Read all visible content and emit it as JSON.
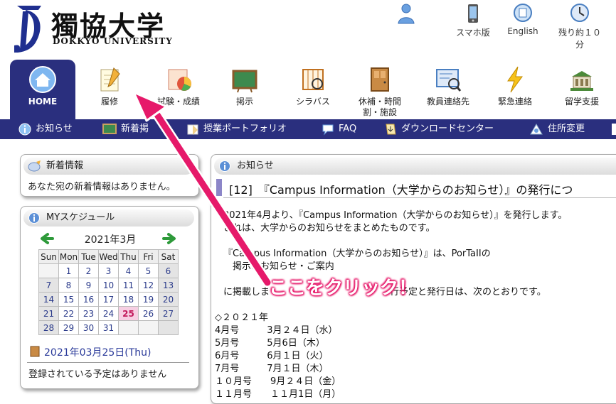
{
  "header": {
    "univ_name_jp": "獨協大学",
    "univ_name_en": "DOKKYO UNIVERSITY",
    "links": [
      {
        "label": "",
        "icon": "user-icon"
      },
      {
        "label": "スマホ版",
        "icon": "smartphone-icon"
      },
      {
        "label": "English",
        "icon": "english-icon"
      },
      {
        "label": "残り約１０分",
        "icon": "clock-icon"
      }
    ]
  },
  "menu": [
    {
      "label": "HOME",
      "icon": "home-icon"
    },
    {
      "label": "履修",
      "icon": "notepad-icon"
    },
    {
      "label": "試験・成績",
      "icon": "chart-icon"
    },
    {
      "label": "掲示",
      "icon": "board-icon"
    },
    {
      "label": "シラバス",
      "icon": "syllabus-icon"
    },
    {
      "label": "休補・時間",
      "label2": "割・施設",
      "icon": "door-icon"
    },
    {
      "label": "教員連絡先",
      "icon": "teacher-contact-icon"
    },
    {
      "label": "緊急連絡",
      "icon": "lightning-icon"
    },
    {
      "label": "留学支援",
      "icon": "building-icon"
    }
  ],
  "subnav": [
    {
      "label": "お知らせ",
      "icon": "info-icon"
    },
    {
      "label": "新着掲",
      "icon": "board-icon"
    },
    {
      "label": "授業ポートフォリオ",
      "icon": "portfolio-icon"
    },
    {
      "label": "FAQ",
      "icon": "faq-icon"
    },
    {
      "label": "ダウンロードセンター",
      "icon": "download-icon"
    },
    {
      "label": "住所変更",
      "icon": "address-icon"
    }
  ],
  "new_info": {
    "title": "新着情報",
    "message": "あなた宛の新着情報はありません。"
  },
  "schedule": {
    "title": "MYスケジュール",
    "month": "2021年3月",
    "weekdays": [
      "Sun",
      "Mon",
      "Tue",
      "Wed",
      "Thu",
      "Fri",
      "Sat"
    ],
    "weeks": [
      [
        "",
        "1",
        "2",
        "3",
        "4",
        "5",
        "6"
      ],
      [
        "7",
        "8",
        "9",
        "10",
        "11",
        "12",
        "13"
      ],
      [
        "14",
        "15",
        "16",
        "17",
        "18",
        "19",
        "20"
      ],
      [
        "21",
        "22",
        "23",
        "24",
        "25",
        "26",
        "27"
      ],
      [
        "28",
        "29",
        "30",
        "31",
        "",
        "",
        ""
      ]
    ],
    "today": "25",
    "selected_date": "2021年03月25日(Thu)",
    "no_events": "登録されている予定はありません"
  },
  "news": {
    "title": "お知らせ",
    "item_title": "[12]　『Campus Information（大学からのお知らせ）』の発行につ",
    "lines": [
      "2021年4月より、『Campus Information（大学からのお知らせ）』を発行します。",
      "これは、大学からのお知らせをまとめたものです。",
      "",
      "『Campus Information（大学からのお知らせ）』は、PorTaIIの",
      "　掲示＞お知らせ・ご案内",
      "",
      "に掲載しま　　　　　　　　　　　　　行予定と発行日は、次のとおりです。",
      "",
      "◇２０２１年",
      "4月号　　　3月２４日（水）",
      "5月号　　　5月6日（木）",
      "6月号　　　6月１日（火）",
      "7月号　　　7月１日（木）",
      "１０月号　　9月２４日（金）",
      "１１月号　　１１月1日（月）"
    ]
  },
  "annotation": {
    "text": "ここをクリック！",
    "color": "#e6196a"
  },
  "colors": {
    "nav": "#2a2f7e",
    "accent_pink": "#e6196a"
  }
}
